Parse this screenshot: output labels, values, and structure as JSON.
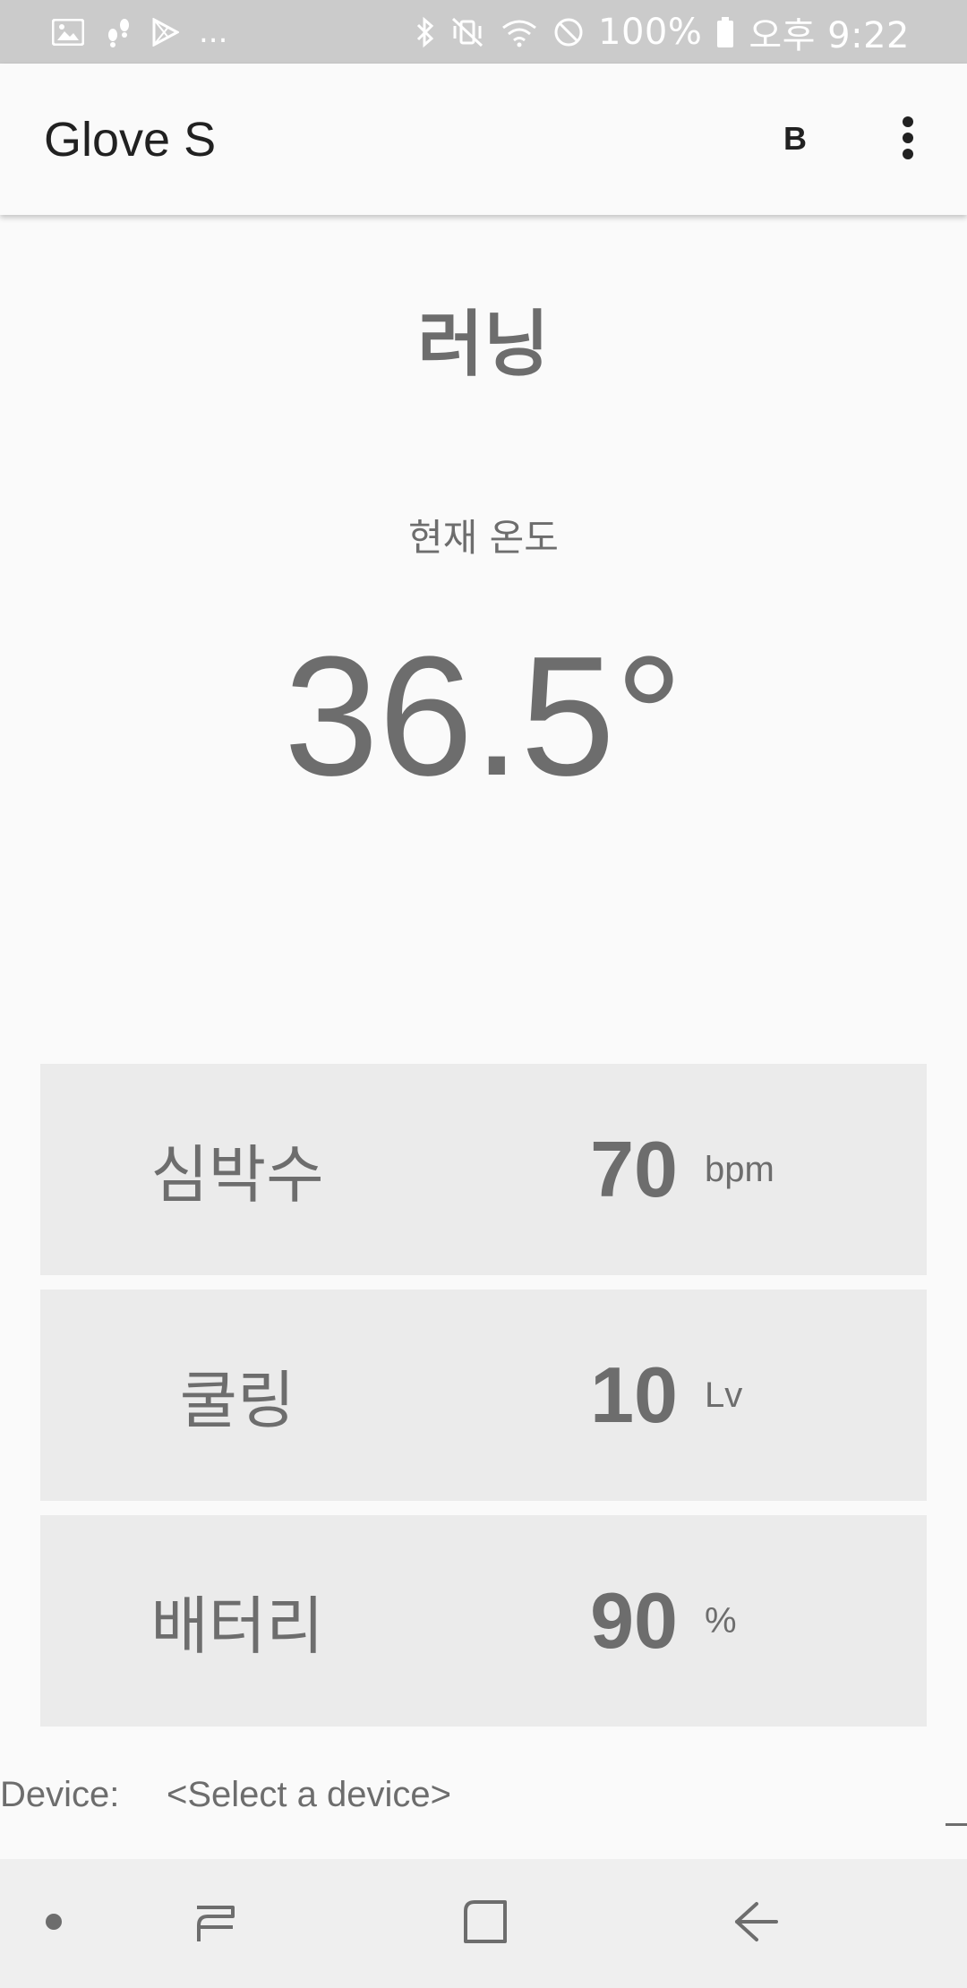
{
  "status_bar": {
    "more_indicator": "...",
    "battery": "100%",
    "time": "오후 9:22"
  },
  "app_bar": {
    "title": "Glove S",
    "bluetooth_button": "B"
  },
  "main": {
    "mode": "러닝",
    "temperature_label": "현재 온도",
    "temperature_value": "36.5°",
    "stats": [
      {
        "label": "심박수",
        "value": "70",
        "unit": "bpm"
      },
      {
        "label": "쿨링",
        "value": "10",
        "unit": "Lv"
      },
      {
        "label": "배터리",
        "value": "90",
        "unit": "%"
      }
    ]
  },
  "device": {
    "label": "Device:",
    "value": "<Select a device>"
  },
  "colors": {
    "status_bar": "#cbcbcb",
    "background": "#fafafa",
    "card": "#ebebeb",
    "text": "#6d6d6d",
    "title_text": "#212121",
    "nav_bar": "#efefef"
  }
}
